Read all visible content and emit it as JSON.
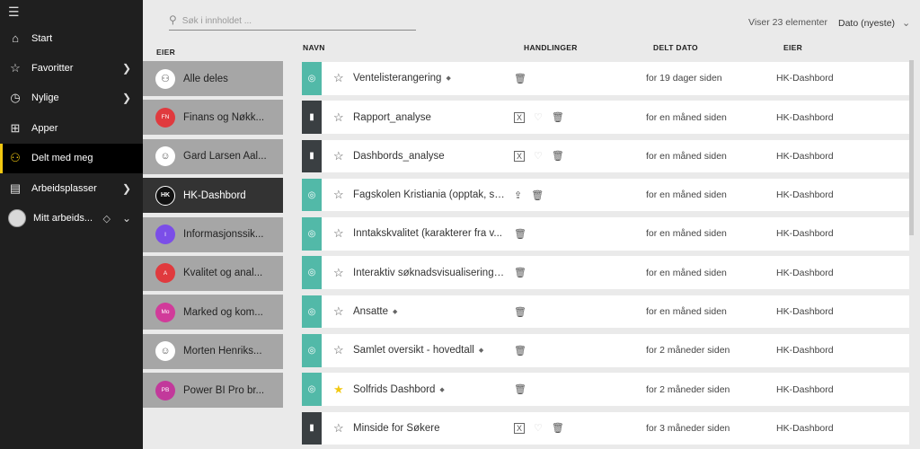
{
  "nav": {
    "menu_icon": "hamburger-icon",
    "items": [
      {
        "label": "Start",
        "icon": "home-icon",
        "chevron": false,
        "active": false
      },
      {
        "label": "Favoritter",
        "icon": "star-icon",
        "chevron": true,
        "active": false
      },
      {
        "label": "Nylige",
        "icon": "clock-icon",
        "chevron": true,
        "active": false
      },
      {
        "label": "Apper",
        "icon": "apps-icon",
        "chevron": false,
        "active": false
      },
      {
        "label": "Delt med meg",
        "icon": "shared-icon",
        "chevron": false,
        "active": true
      },
      {
        "label": "Arbeidsplasser",
        "icon": "workspaces-icon",
        "chevron": true,
        "active": false
      }
    ],
    "my_workspace": "Mitt arbeids..."
  },
  "search": {
    "placeholder": "Søk i innholdet ..."
  },
  "count_text": "Viser 23 elementer",
  "sort": {
    "label": "Dato (nyeste)"
  },
  "owner_column": {
    "header": "EIER",
    "items": [
      {
        "label": "Alle deles",
        "initials": ""
      },
      {
        "label": "Finans og Nøkk...",
        "initials": "FN"
      },
      {
        "label": "Gard Larsen Aal...",
        "initials": ""
      },
      {
        "label": "HK-Dashbord",
        "initials": "HK"
      },
      {
        "label": "Informasjonssik...",
        "initials": "I"
      },
      {
        "label": "Kvalitet og anal...",
        "initials": "A"
      },
      {
        "label": "Marked og kom...",
        "initials": "Mo"
      },
      {
        "label": "Morten Henriks...",
        "initials": ""
      },
      {
        "label": "Power BI Pro br...",
        "initials": "PB"
      }
    ]
  },
  "columns": {
    "name": "NAVN",
    "actions": "HANDLINGER",
    "shared_date": "DELT DATO",
    "owner": "EIER"
  },
  "rows": [
    {
      "name": "Ventelisterangering",
      "date": "for 19 dager siden",
      "owner": "HK-Dashbord"
    },
    {
      "name": "Rapport_analyse",
      "date": "for en måned siden",
      "owner": "HK-Dashbord"
    },
    {
      "name": "Dashbords_analyse",
      "date": "for en måned siden",
      "owner": "HK-Dashbord"
    },
    {
      "name": "Fagskolen Kristiania (opptak, sø...",
      "date": "for en måned siden",
      "owner": "HK-Dashbord"
    },
    {
      "name": "Inntakskvalitet (karakterer fra v...",
      "date": "for en måned siden",
      "owner": "HK-Dashbord"
    },
    {
      "name": "Interaktiv søknadsvisualisering (...",
      "date": "for en måned siden",
      "owner": "HK-Dashbord"
    },
    {
      "name": "Ansatte",
      "date": "for en måned siden",
      "owner": "HK-Dashbord"
    },
    {
      "name": "Samlet oversikt - hovedtall",
      "date": "for 2 måneder siden",
      "owner": "HK-Dashbord"
    },
    {
      "name": "Solfrids Dashbord",
      "date": "for 2 måneder siden",
      "owner": "HK-Dashbord"
    },
    {
      "name": "Minside for Søkere",
      "date": "for 3 måneder siden",
      "owner": "HK-Dashbord"
    }
  ],
  "colors": {
    "accent": "#f2c811",
    "dashboard": "#52b9a8",
    "report": "#3a3f42"
  }
}
